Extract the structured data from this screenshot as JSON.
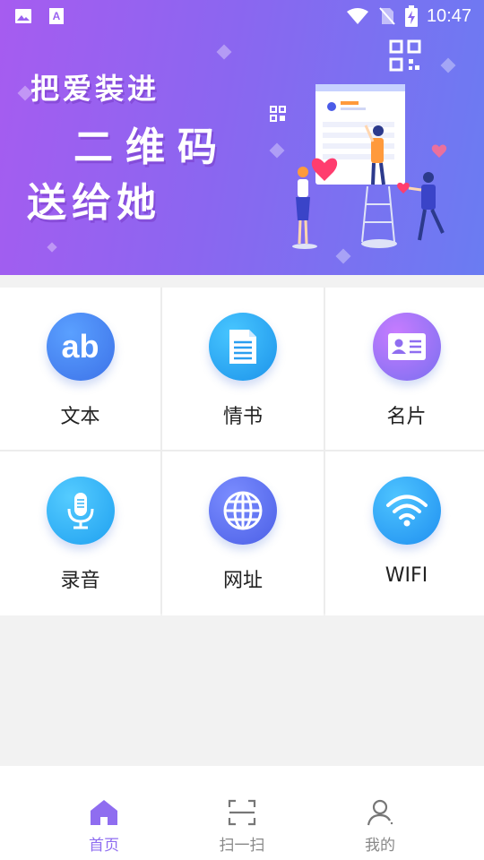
{
  "status_bar": {
    "time": "10:47",
    "left_icons": [
      "image-icon",
      "font-icon"
    ],
    "right_icons": [
      "wifi-icon",
      "no-sim-icon",
      "battery-charging-icon"
    ]
  },
  "banner": {
    "line1": "把爱装进",
    "line2": "二维码",
    "line3": "送给她"
  },
  "features": [
    {
      "label": "文本",
      "icon": "text-ab-icon",
      "color": "#4d8ff0"
    },
    {
      "label": "情书",
      "icon": "document-icon",
      "color": "#2aa8f0"
    },
    {
      "label": "名片",
      "icon": "business-card-icon",
      "color": "#a068f0"
    },
    {
      "label": "录音",
      "icon": "microphone-icon",
      "color": "#2fb5f5"
    },
    {
      "label": "网址",
      "icon": "globe-icon",
      "color": "#5b74f0"
    },
    {
      "label": "WIFI",
      "icon": "wifi-icon",
      "color": "#2aa6f3"
    }
  ],
  "bottom_nav": [
    {
      "label": "首页",
      "icon": "home-icon",
      "active": true
    },
    {
      "label": "扫一扫",
      "icon": "scan-icon",
      "active": false
    },
    {
      "label": "我的",
      "icon": "user-icon",
      "active": false
    }
  ],
  "colors": {
    "accent": "#8f6df0",
    "banner_start": "#a65cf0",
    "banner_end": "#6a7cf2"
  }
}
